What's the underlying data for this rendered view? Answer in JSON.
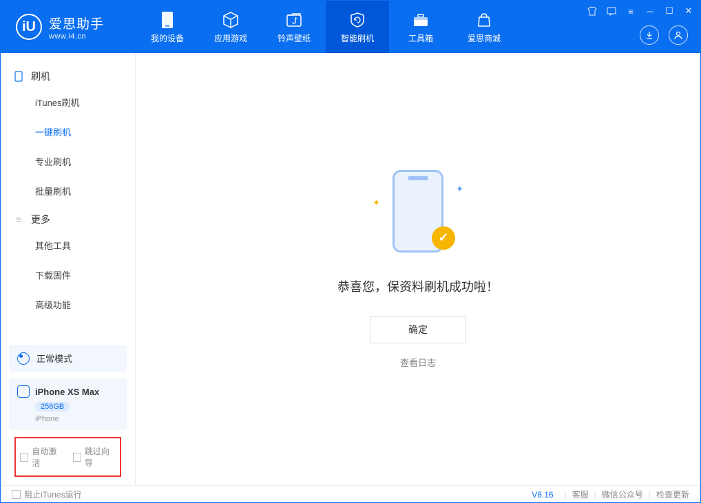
{
  "logo": {
    "cn": "爱思助手",
    "en": "www.i4.cn",
    "mark": "iU"
  },
  "nav": [
    {
      "label": "我的设备"
    },
    {
      "label": "应用游戏"
    },
    {
      "label": "铃声壁纸"
    },
    {
      "label": "智能刷机"
    },
    {
      "label": "工具箱"
    },
    {
      "label": "爱思商城"
    }
  ],
  "sidebar": {
    "group1": "刷机",
    "items1": [
      "iTunes刷机",
      "一键刷机",
      "专业刷机",
      "批量刷机"
    ],
    "group2": "更多",
    "items2": [
      "其他工具",
      "下载固件",
      "高级功能"
    ]
  },
  "mode": {
    "label": "正常模式"
  },
  "device": {
    "name": "iPhone XS Max",
    "capacity": "256GB",
    "type": "iPhone"
  },
  "options": {
    "auto_activate": "自动激活",
    "skip_guide": "跳过向导"
  },
  "main": {
    "success": "恭喜您，保资料刷机成功啦！",
    "ok": "确定",
    "view_log": "查看日志"
  },
  "footer": {
    "block_itunes": "阻止iTunes运行",
    "version": "V8.16",
    "support": "客服",
    "wechat": "微信公众号",
    "check_update": "检查更新"
  }
}
